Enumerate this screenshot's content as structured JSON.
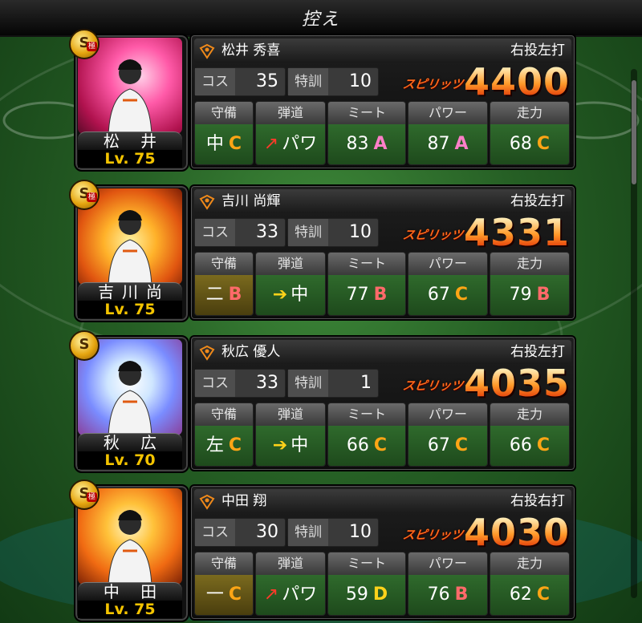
{
  "header": {
    "title": "控え"
  },
  "labels": {
    "cost": "コス",
    "training": "特訓",
    "spirits": "スピリッツ",
    "defense": "守備",
    "trajectory": "弾道",
    "meet": "ミート",
    "power": "パワー",
    "speed": "走力"
  },
  "players": [
    {
      "card_name": "松 井",
      "level": "Lv. 75",
      "badge": "S",
      "kiwami": "極",
      "full_name": "松井 秀喜",
      "throw_bat": "右投左打",
      "cost": "35",
      "training": "10",
      "spirits": "4400",
      "defense_pos": "中",
      "defense_grade": "C",
      "trajectory_arrow": "↗",
      "trajectory_type": "パワ",
      "meet_value": "83",
      "meet_grade": "A",
      "power_value": "87",
      "power_grade": "A",
      "speed_value": "68",
      "speed_grade": "C",
      "art": "art-pink",
      "arrow_color": "#ff3a2a",
      "defense_bg": "green"
    },
    {
      "card_name": "吉川尚",
      "level": "Lv. 75",
      "badge": "S",
      "kiwami": "極",
      "full_name": "吉川 尚輝",
      "throw_bat": "右投左打",
      "cost": "33",
      "training": "10",
      "spirits": "4331",
      "defense_pos": "二",
      "defense_grade": "B",
      "trajectory_arrow": "➔",
      "trajectory_type": "中",
      "meet_value": "77",
      "meet_grade": "B",
      "power_value": "67",
      "power_grade": "C",
      "speed_value": "79",
      "speed_grade": "B",
      "art": "art-fire",
      "arrow_color": "#ffd21a",
      "defense_bg": "gold"
    },
    {
      "card_name": "秋 広",
      "level": "Lv. 70",
      "badge": "S",
      "kiwami": "",
      "full_name": "秋広 優人",
      "throw_bat": "右投左打",
      "cost": "33",
      "training": "1",
      "spirits": "4035",
      "defense_pos": "左",
      "defense_grade": "C",
      "trajectory_arrow": "➔",
      "trajectory_type": "中",
      "meet_value": "66",
      "meet_grade": "C",
      "power_value": "67",
      "power_grade": "C",
      "speed_value": "66",
      "speed_grade": "C",
      "art": "art-blue",
      "arrow_color": "#ffd21a",
      "defense_bg": "green"
    },
    {
      "card_name": "中 田",
      "level": "Lv. 75",
      "badge": "S",
      "kiwami": "極",
      "full_name": "中田 翔",
      "throw_bat": "右投右打",
      "cost": "30",
      "training": "10",
      "spirits": "4030",
      "defense_pos": "一",
      "defense_grade": "C",
      "trajectory_arrow": "↗",
      "trajectory_type": "パワ",
      "meet_value": "59",
      "meet_grade": "D",
      "power_value": "76",
      "power_grade": "B",
      "speed_value": "62",
      "speed_grade": "C",
      "art": "art-fire2",
      "arrow_color": "#ff3a2a",
      "defense_bg": "gold"
    }
  ]
}
